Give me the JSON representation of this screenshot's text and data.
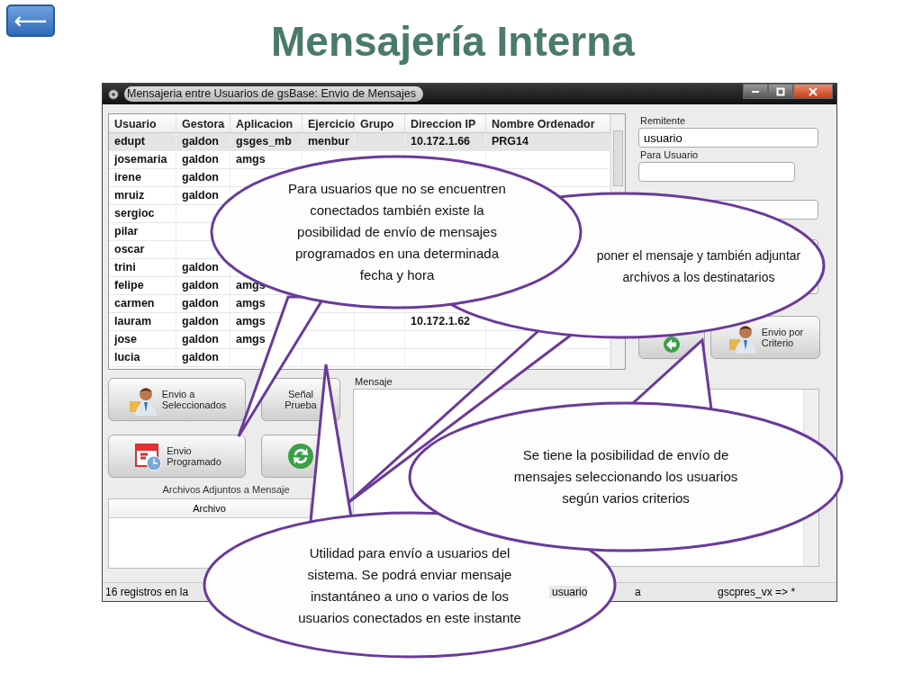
{
  "back_button": {
    "label": "⟵"
  },
  "title": "Mensajería Interna",
  "window": {
    "title": "Mensajeria entre Usuarios de gsBase: Envio de Mensajes",
    "table": {
      "columns": [
        "Usuario",
        "Gestora",
        "Aplicacion",
        "Ejercicio",
        "Grupo",
        "Direccion IP",
        "Nombre Ordenador"
      ],
      "rows": [
        {
          "selected": true,
          "cells": [
            "edupt",
            "galdon",
            "gsges_mb",
            "menbur",
            null,
            "10.172.1.66",
            "PRG14"
          ]
        },
        {
          "selected": false,
          "cells": [
            "josemaria",
            "galdon",
            "amgs",
            null,
            null,
            null,
            null
          ]
        },
        {
          "selected": false,
          "cells": [
            "irene",
            "galdon",
            null,
            null,
            null,
            null,
            null
          ]
        },
        {
          "selected": false,
          "cells": [
            "mruiz",
            "galdon",
            null,
            null,
            null,
            null,
            null
          ]
        },
        {
          "selected": false,
          "cells": [
            "sergioc",
            null,
            null,
            null,
            null,
            null,
            null
          ]
        },
        {
          "selected": false,
          "cells": [
            "pilar",
            null,
            null,
            null,
            null,
            null,
            null
          ]
        },
        {
          "selected": false,
          "cells": [
            "oscar",
            null,
            null,
            null,
            null,
            null,
            null
          ]
        },
        {
          "selected": false,
          "cells": [
            "trini",
            "galdon",
            null,
            null,
            null,
            null,
            null
          ]
        },
        {
          "selected": false,
          "cells": [
            "felipe",
            "galdon",
            "amgs",
            null,
            null,
            null,
            null
          ]
        },
        {
          "selected": false,
          "cells": [
            "carmen",
            "galdon",
            "amgs",
            null,
            null,
            null,
            null
          ]
        },
        {
          "selected": false,
          "cells": [
            "lauram",
            "galdon",
            "amgs",
            null,
            null,
            "10.172.1.62",
            null
          ]
        },
        {
          "selected": false,
          "cells": [
            "jose",
            "galdon",
            "amgs",
            null,
            null,
            null,
            null
          ]
        },
        {
          "selected": false,
          "cells": [
            "lucia",
            "galdon",
            null,
            null,
            null,
            null,
            null
          ]
        }
      ]
    },
    "remitente": {
      "label": "Remitente",
      "value": "usuario"
    },
    "para_usuario": {
      "label": "Para Usuario"
    },
    "right_buttons": [
      {
        "kind": "person-arrow"
      },
      {
        "kind": "person",
        "label": "Envio por\nCriterio"
      }
    ],
    "left_buttons": [
      {
        "kind": "person",
        "label": "Envio a\nSeleccionados"
      },
      {
        "kind": "text",
        "label": "Señal\nPrueba"
      },
      {
        "kind": "calendar",
        "label": "Envio\nProgramado"
      },
      {
        "kind": "refresh"
      }
    ],
    "attachments": {
      "title": "Archivos Adjuntos a Mensaje",
      "column": "Archivo"
    },
    "message": {
      "label": "Mensaje"
    },
    "status_bar": [
      "16 registros en la",
      "usuario",
      "a",
      "gscpres_vx => *"
    ]
  },
  "callouts": [
    {
      "text": "Para usuarios que no se encuentren conectados también existe la posibilidad de envío de mensajes programados en una determinada fecha y hora"
    },
    {
      "text": "poner el mensaje y también adjuntar archivos a los destinatarios"
    },
    {
      "text": "Utilidad para envío a usuarios del sistema. Se podrá enviar mensaje instantáneo a uno o varios de los usuarios conectados en este instante"
    },
    {
      "text": "Se tiene la posibilidad de envío de mensajes seleccionando los usuarios según varios criterios"
    }
  ]
}
